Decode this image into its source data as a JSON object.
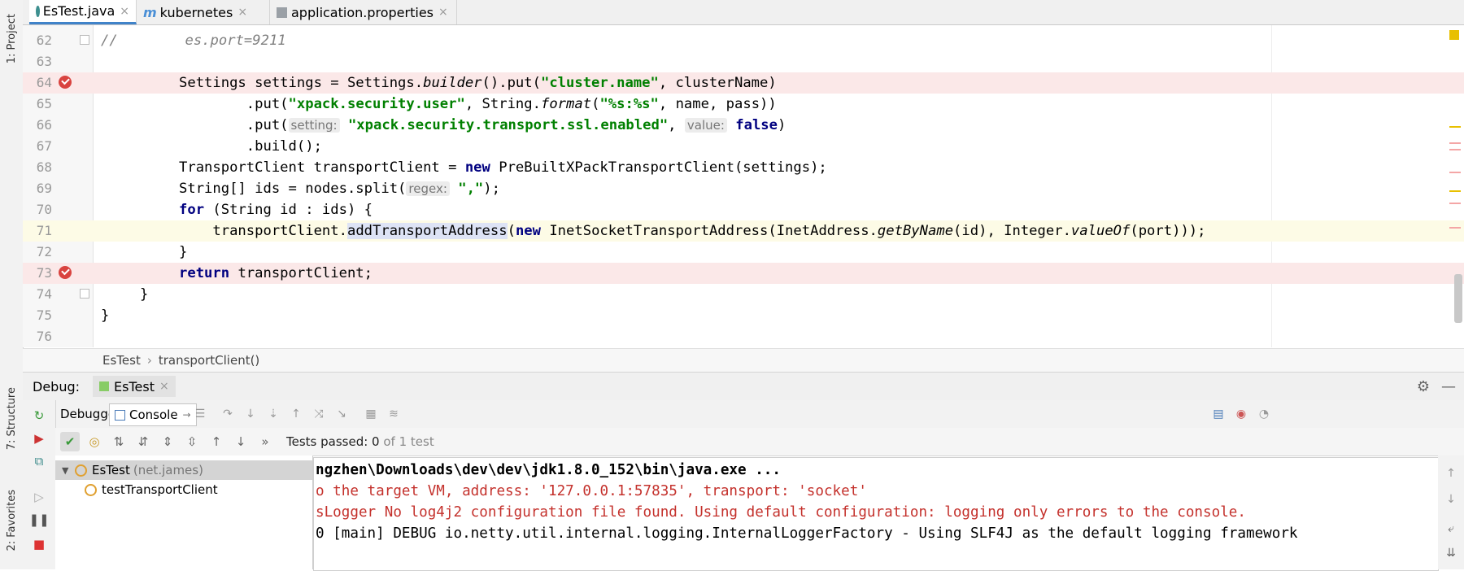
{
  "left_strip": {
    "project_label": "1: Project",
    "structure_label": "7: Structure",
    "favorites_label": "2: Favorites"
  },
  "tabs": [
    {
      "label": "EsTest.java",
      "icon": "java-class-icon",
      "active": true
    },
    {
      "label": "kubernetes",
      "icon": "kubernetes-m-icon",
      "active": false
    },
    {
      "label": "application.properties",
      "icon": "properties-icon",
      "active": false
    }
  ],
  "editor": {
    "lines": [
      {
        "num": "62"
      },
      {
        "num": "63"
      },
      {
        "num": "64"
      },
      {
        "num": "65"
      },
      {
        "num": "66"
      },
      {
        "num": "67"
      },
      {
        "num": "68"
      },
      {
        "num": "69"
      },
      {
        "num": "70"
      },
      {
        "num": "71"
      },
      {
        "num": "72"
      },
      {
        "num": "73"
      },
      {
        "num": "74"
      },
      {
        "num": "75"
      },
      {
        "num": "76"
      }
    ],
    "tokens": {
      "l62_comment": "//        es.port=9211",
      "l64_a": "Settings settings = Settings.",
      "l64_b": "builder",
      "l64_c": "().put(",
      "l64_d": "\"cluster.name\"",
      "l64_e": ", clusterName)",
      "l65_a": "        .put(",
      "l65_b": "\"xpack.security.user\"",
      "l65_c": ", String.",
      "l65_d": "format",
      "l65_e": "(",
      "l65_f": "\"%s:%s\"",
      "l65_g": ", name, pass))",
      "l66_a": "        .put(",
      "l66_hint1": "setting:",
      "l66_b": "\"xpack.security.transport.ssl.enabled\"",
      "l66_c": ", ",
      "l66_hint2": "value:",
      "l66_d": "false",
      "l66_e": ")",
      "l67": "        .build();",
      "l68_a": "TransportClient transportClient = ",
      "l68_b": "new",
      "l68_c": " PreBuiltXPackTransportClient(settings);",
      "l69_a": "String[] ids = nodes.split(",
      "l69_hint": "regex:",
      "l69_b": "\",\"",
      "l69_c": ");",
      "l70_a": "for",
      "l70_b": " (String id : ids) {",
      "l71_a": "    transportClient.",
      "l71_b": "addTransportAddress",
      "l71_c": "(",
      "l71_d": "new",
      "l71_e": " InetSocketTransportAddress(InetAddress.",
      "l71_f": "getByName",
      "l71_g": "(id), Integer.",
      "l71_h": "valueOf",
      "l71_i": "(port)));",
      "l72": "}",
      "l73_a": "return",
      "l73_b": " transportClient;",
      "l74": "}",
      "l75": "}"
    }
  },
  "breadcrumb": {
    "items": [
      "EsTest",
      "transportClient()"
    ],
    "separator": "›"
  },
  "debug": {
    "label": "Debug:",
    "tab": "EsTest",
    "subtabs": {
      "debugger": "Debugger",
      "console": "Console"
    },
    "test_status": {
      "prefix": "Tests passed: ",
      "count": "0",
      "suffix": " of 1 test"
    },
    "tree": [
      {
        "name": "EsTest",
        "pkg": "(net.james)"
      },
      {
        "name": "testTransportClient"
      }
    ],
    "console_lines": [
      {
        "text": "ngzhen\\Downloads\\dev\\dev\\jdk1.8.0_152\\bin\\java.exe ...",
        "kind": "cmd"
      },
      {
        "text": "o the target VM, address: '127.0.0.1:57835', transport: 'socket'",
        "kind": "err"
      },
      {
        "text": "sLogger No log4j2 configuration file found. Using default configuration: logging only errors to the console.",
        "kind": "err"
      },
      {
        "text": "0 [main] DEBUG io.netty.util.internal.logging.InternalLoggerFactory - Using SLF4J as the default logging framework",
        "kind": "info"
      }
    ]
  },
  "colors": {
    "keyword": "#000080",
    "string": "#008000",
    "breakpoint": "#d9433f",
    "error_text": "#c4312c",
    "active_tab_border": "#4083c9"
  }
}
